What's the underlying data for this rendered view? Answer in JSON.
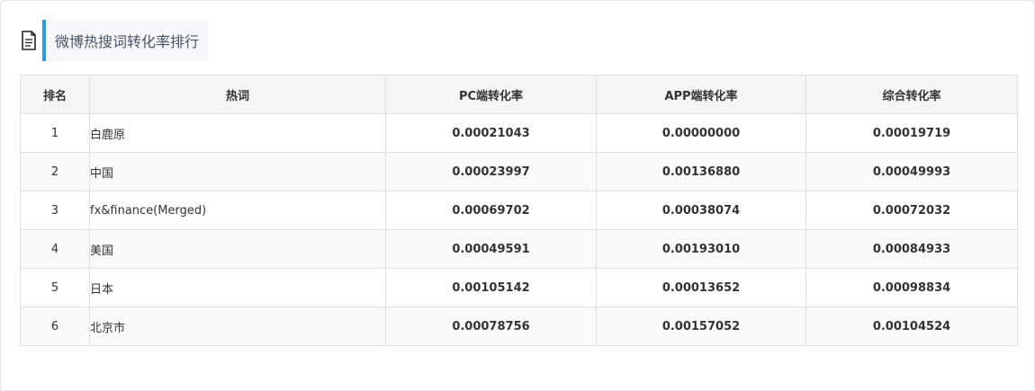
{
  "header": {
    "icon": "document-icon",
    "title": "微博热搜词转化率排行"
  },
  "colors": {
    "accent": "#3399dd",
    "header_bg": "#f5f5f5",
    "alt_row_bg": "#f9f9f9",
    "border": "#e0e0e0"
  },
  "table": {
    "columns": [
      "排名",
      "热词",
      "PC端转化率",
      "APP端转化率",
      "综合转化率"
    ],
    "rows": [
      {
        "rank": "1",
        "name": "白鹿原",
        "pc": "0.00021043",
        "app": "0.00000000",
        "total": "0.00019719"
      },
      {
        "rank": "2",
        "name": "中国",
        "pc": "0.00023997",
        "app": "0.00136880",
        "total": "0.00049993"
      },
      {
        "rank": "3",
        "name": "fx&finance(Merged)",
        "pc": "0.00069702",
        "app": "0.00038074",
        "total": "0.00072032"
      },
      {
        "rank": "4",
        "name": "美国",
        "pc": "0.00049591",
        "app": "0.00193010",
        "total": "0.00084933"
      },
      {
        "rank": "5",
        "name": "日本",
        "pc": "0.00105142",
        "app": "0.00013652",
        "total": "0.00098834"
      },
      {
        "rank": "6",
        "name": "北京市",
        "pc": "0.00078756",
        "app": "0.00157052",
        "total": "0.00104524"
      }
    ]
  }
}
